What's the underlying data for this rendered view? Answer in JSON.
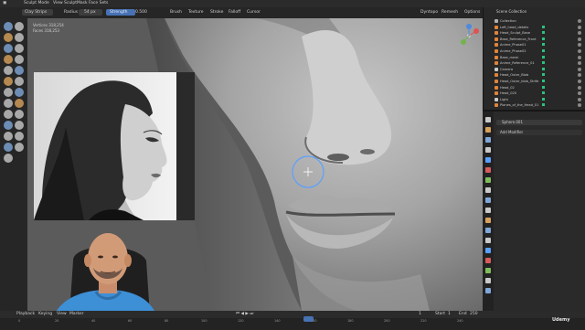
{
  "menu": {
    "mode": "Sculpt Mode",
    "items": [
      "View",
      "Sculpt",
      "Mask",
      "Face Sets"
    ],
    "workspace": "Udemy"
  },
  "tool_header": {
    "brush": "Clay Strips",
    "radius_label": "Radius",
    "radius_value": "54 px",
    "strength_label": "Strength",
    "strength_value": "0.500",
    "panels": [
      "Brush",
      "Texture",
      "Stroke",
      "Falloff",
      "Cursor"
    ],
    "overlays": "Dyntopo",
    "remesh": "Remesh",
    "options": "Options"
  },
  "stats": {
    "vertices_label": "Vertices",
    "vertices_value": "318,254",
    "faces_label": "Faces",
    "faces_value": "318,253"
  },
  "outliner": {
    "title": "Scene Collection",
    "items": [
      {
        "label": "Collection",
        "color": "#b0b0b0"
      },
      {
        "label": "Left_head_details",
        "color": "#e0843a"
      },
      {
        "label": "Head_Sculpt_Base",
        "color": "#e0843a"
      },
      {
        "label": "Base_Reference_Front",
        "color": "#e0843a"
      },
      {
        "label": "Anime_Phase01",
        "color": "#e0843a"
      },
      {
        "label": "Anime_Phase02",
        "color": "#e0843a"
      },
      {
        "label": "Base_mesh",
        "color": "#e0843a"
      },
      {
        "label": "Anime_Reference_01",
        "color": "#e0843a"
      },
      {
        "label": "Camera",
        "color": "#c8c8c8"
      },
      {
        "label": "Head_Outer_Blob",
        "color": "#e0843a"
      },
      {
        "label": "Head_Outer_blob_Strife",
        "color": "#e0843a"
      },
      {
        "label": "Head_02",
        "color": "#e0843a"
      },
      {
        "label": "Head_020",
        "color": "#e0843a"
      },
      {
        "label": "Light",
        "color": "#c8c8c8"
      },
      {
        "label": "Planes_of_the_Head_01",
        "color": "#e0843a"
      }
    ]
  },
  "properties": {
    "object": "Sphere.001",
    "add_modifier": "Add Modifier"
  },
  "timeline": {
    "menus": [
      "Playback",
      "Keying",
      "View",
      "Marker"
    ],
    "current_frame": "1",
    "start_label": "Start",
    "start_value": "1",
    "end_label": "End",
    "end_value": "250",
    "ticks": [
      "0",
      "20",
      "40",
      "60",
      "80",
      "100",
      "120",
      "140",
      "160",
      "180",
      "200",
      "220",
      "240"
    ]
  },
  "colors": {
    "accent": "#4772b3",
    "brush_ring": "#5aa0ff",
    "outliner_filter": "#2bc27c"
  }
}
